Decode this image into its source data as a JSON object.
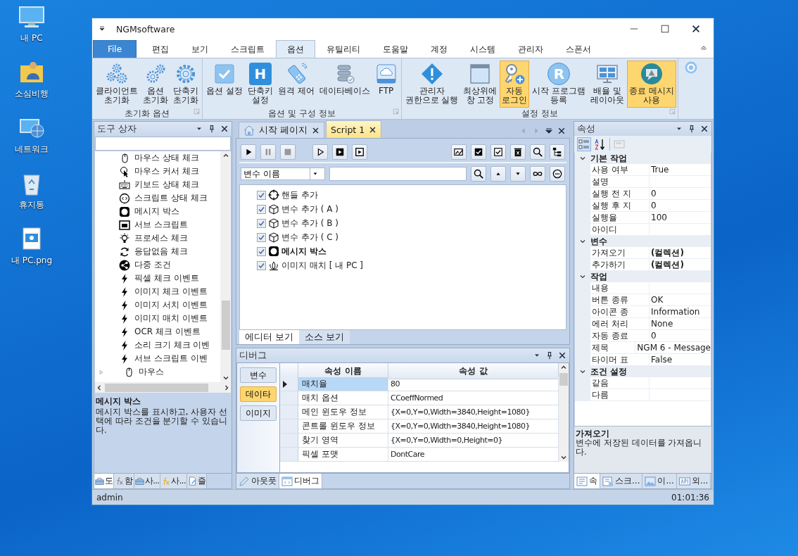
{
  "desktop_icons": [
    {
      "label": "내 PC"
    },
    {
      "label": "소심비행"
    },
    {
      "label": "네트워크"
    },
    {
      "label": "휴지통"
    },
    {
      "label": "내 PC.png"
    }
  ],
  "window": {
    "title": "NGMsoftware"
  },
  "ribbon": {
    "tabs": [
      {
        "label": "File",
        "kind": "file",
        "selected": false
      },
      {
        "label": "편집",
        "kind": "tab",
        "selected": false
      },
      {
        "label": "보기",
        "kind": "tab",
        "selected": false
      },
      {
        "label": "스크립트",
        "kind": "tab",
        "selected": false
      },
      {
        "label": "옵션",
        "kind": "tab",
        "selected": true
      },
      {
        "label": "유틸리티",
        "kind": "tab",
        "selected": false
      },
      {
        "label": "도움말",
        "kind": "tab",
        "selected": false
      },
      {
        "label": "계정",
        "kind": "tab",
        "selected": false
      },
      {
        "label": "시스템",
        "kind": "tab",
        "selected": false
      },
      {
        "label": "관리자",
        "kind": "tab",
        "selected": false
      },
      {
        "label": "스폰서",
        "kind": "tab",
        "selected": false
      }
    ],
    "groups": [
      {
        "label": "초기화 옵션",
        "buttons": [
          {
            "label": "클라이언트\n초기화",
            "checked": false
          },
          {
            "label": "옵션\n초기화",
            "checked": false
          },
          {
            "label": "단축키\n초기화",
            "checked": false
          }
        ]
      },
      {
        "label": "옵션 및 구성 정보",
        "buttons": [
          {
            "label": "옵션 설정",
            "checked": false
          },
          {
            "label": "단축키\n설정",
            "glyph": "H",
            "checked": false
          },
          {
            "label": "원격 제어",
            "checked": false
          },
          {
            "label": "데이타베이스",
            "checked": false
          },
          {
            "label": "FTP",
            "checked": false
          }
        ]
      },
      {
        "label": "설정 정보",
        "buttons": [
          {
            "label": "관리자\n권한으로 실행",
            "checked": false
          },
          {
            "label": "최상위에\n창 고정",
            "checked": false
          },
          {
            "label": "자동\n로그인",
            "checked": true
          },
          {
            "label": "시작 프로그램\n등록",
            "glyph": "R",
            "checked": false
          },
          {
            "label": "배율 및\n레이아웃",
            "checked": false
          },
          {
            "label": "종료 메시지\n사용",
            "checked": true
          }
        ]
      }
    ]
  },
  "toolbox": {
    "title": "도구 상자",
    "items": [
      {
        "label": "마우스 상태 체크",
        "kind": "item"
      },
      {
        "label": "마우스 커서 체크",
        "kind": "item"
      },
      {
        "label": "키보드 상태 체크",
        "kind": "item"
      },
      {
        "label": "스크립트 상태 체크",
        "kind": "item"
      },
      {
        "label": "메시지 박스",
        "kind": "item"
      },
      {
        "label": "서브 스크립트",
        "kind": "item"
      },
      {
        "label": "프로세스 체크",
        "kind": "item"
      },
      {
        "label": "응답없음 체크",
        "kind": "item"
      },
      {
        "label": "다중 조건",
        "kind": "item"
      },
      {
        "label": "픽셀 체크 이벤트",
        "kind": "item"
      },
      {
        "label": "이미지 체크 이벤트",
        "kind": "item"
      },
      {
        "label": "이미지 서치 이벤트",
        "kind": "item"
      },
      {
        "label": "이미지 매치 이벤트",
        "kind": "item"
      },
      {
        "label": "OCR 체크 이벤트",
        "kind": "item"
      },
      {
        "label": "소리 크기 체크 이벤",
        "kind": "item"
      },
      {
        "label": "서브 스크립트 이벤",
        "kind": "item"
      },
      {
        "label": "마우스",
        "kind": "group",
        "expanded": false
      }
    ],
    "description": {
      "title": "메시지 박스",
      "text": "메시지 박스를 표시하고, 사용자 선택에 따라 조건을 분기할 수 있습니다."
    },
    "tabs": [
      {
        "label": "도",
        "selected": true
      },
      {
        "label": "함",
        "selected": false
      },
      {
        "label": "사...",
        "selected": false
      },
      {
        "label": "사...",
        "selected": false
      },
      {
        "label": "즐",
        "selected": false
      }
    ]
  },
  "editor": {
    "tabs": [
      {
        "label": "시작 페이지",
        "selected": false
      },
      {
        "label": "Script 1",
        "selected": true
      }
    ],
    "search": {
      "field": "변수 이름"
    },
    "items": [
      {
        "label": "핸들 추가",
        "checked": true,
        "selected": false
      },
      {
        "label": "변수 추가 ( A )",
        "checked": true,
        "selected": false
      },
      {
        "label": "변수 추가 ( B )",
        "checked": true,
        "selected": false
      },
      {
        "label": "변수 추가 ( C )",
        "checked": true,
        "selected": false
      },
      {
        "label": "메시지 박스",
        "checked": true,
        "selected": true
      },
      {
        "label": "이미지 매치 [ 내 PC ]",
        "checked": true,
        "selected": false
      }
    ],
    "view_tabs": [
      {
        "label": "에디터 보기",
        "selected": true
      },
      {
        "label": "소스 보기",
        "selected": false
      }
    ]
  },
  "debug": {
    "title": "디버그",
    "side_buttons": [
      {
        "label": "변수",
        "selected": false
      },
      {
        "label": "데이타",
        "selected": true
      },
      {
        "label": "이미지",
        "selected": false
      }
    ],
    "columns": [
      "속성 이름",
      "속성 값"
    ],
    "rows": [
      {
        "name": "매치율",
        "value": "80",
        "selected": true
      },
      {
        "name": "매치 옵션",
        "value": "CCoeffNormed",
        "selected": false
      },
      {
        "name": "메인 윈도우 정보",
        "value": "{X=0,Y=0,Width=3840,Height=1080}",
        "selected": false
      },
      {
        "name": "콘트롤 윈도우 정보",
        "value": "{X=0,Y=0,Width=3840,Height=1080}",
        "selected": false
      },
      {
        "name": "찾기 영역",
        "value": "{X=0,Y=0,Width=0,Height=0}",
        "selected": false
      },
      {
        "name": "픽셀 포맷",
        "value": "DontCare",
        "selected": false
      }
    ]
  },
  "bottom_tabs": [
    {
      "label": "아웃풋",
      "selected": false
    },
    {
      "label": "디버그",
      "selected": true
    }
  ],
  "properties": {
    "title": "속성",
    "categorized": true,
    "categories": [
      {
        "label": "기본 작업",
        "expanded": true,
        "rows": [
          {
            "name": "사용 여부",
            "value": "True",
            "bold": false
          },
          {
            "name": "설명"
          },
          {
            "name": "실행 전 지",
            "value": "0",
            "bold": false
          },
          {
            "name": "실행 후 지",
            "value": "0",
            "bold": false
          },
          {
            "name": "실행율",
            "value": "100",
            "bold": false
          },
          {
            "name": "아이디"
          }
        ]
      },
      {
        "label": "변수",
        "expanded": true,
        "rows": [
          {
            "name": "가져오기",
            "value": "(컬렉션)",
            "bold": true
          },
          {
            "name": "추가하기",
            "value": "(컬렉션)",
            "bold": true
          }
        ]
      },
      {
        "label": "작업",
        "expanded": true,
        "rows": [
          {
            "name": "내용"
          },
          {
            "name": "버튼 종류",
            "value": "OK",
            "bold": false
          },
          {
            "name": "아이콘 종",
            "value": "Information",
            "bold": false
          },
          {
            "name": "에러 처리",
            "value": "None",
            "bold": false
          },
          {
            "name": "자동 종료",
            "value": "0",
            "bold": false
          },
          {
            "name": "제목",
            "value": "NGM 6 - Message",
            "bold": false
          },
          {
            "name": "타이머 표",
            "value": "False",
            "bold": false
          }
        ]
      },
      {
        "label": "조건 설정",
        "expanded": true,
        "rows": [
          {
            "name": "같음"
          },
          {
            "name": "다름"
          }
        ]
      }
    ],
    "description": {
      "title": "가져오기",
      "text": "변수에 저장된 데이터를 가져옵니다."
    },
    "tabs": [
      {
        "label": "속",
        "selected": true
      },
      {
        "label": "스크...",
        "selected": false
      },
      {
        "label": "이...",
        "selected": false
      },
      {
        "label": "외...",
        "selected": false
      }
    ]
  },
  "status_bar": {
    "user": "admin",
    "time": "01:01:36"
  }
}
